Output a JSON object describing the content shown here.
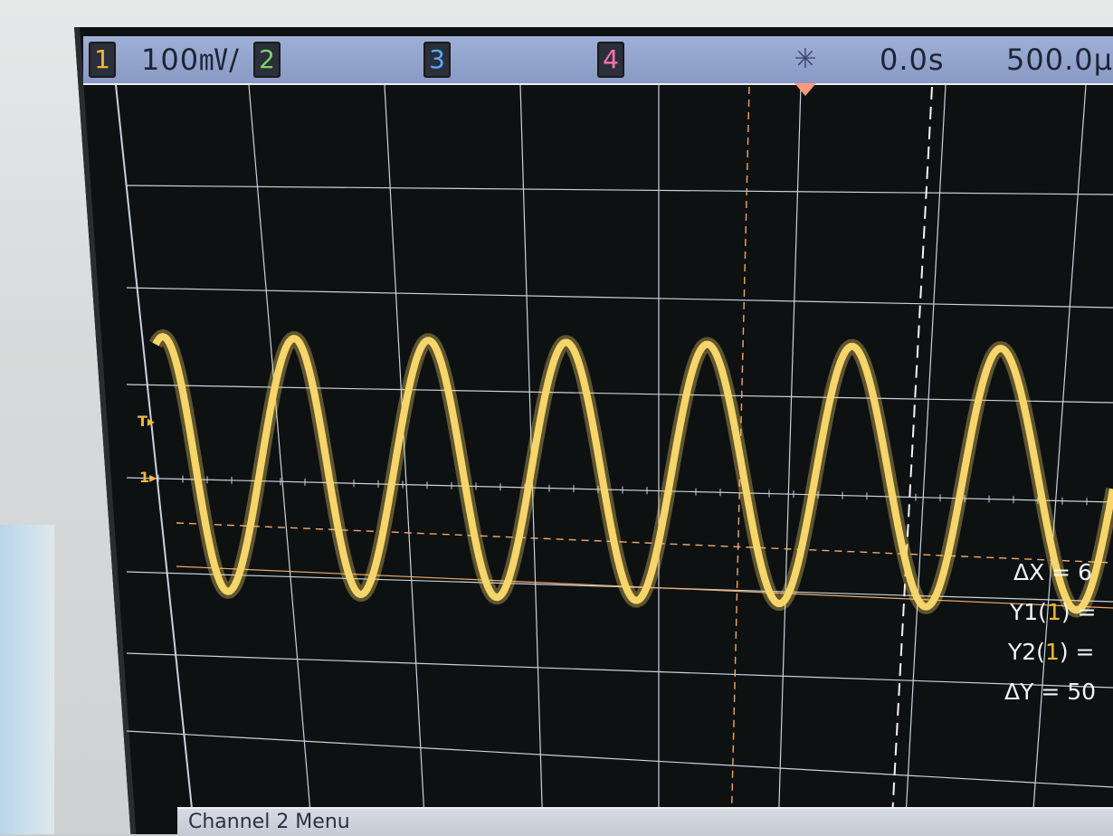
{
  "status_bar": {
    "channels": [
      {
        "label": "1",
        "color": "#f2b836"
      },
      {
        "label": "2",
        "color": "#7fd36a"
      },
      {
        "label": "3",
        "color": "#5ba8ff"
      },
      {
        "label": "4",
        "color": "#ff72b4"
      }
    ],
    "ch1_scale": "100㎷/",
    "acquire_icon": "starburst-icon",
    "trigger_delay": "0.0s",
    "timebase": "500.0µ/"
  },
  "markers": {
    "trigger_label": "T",
    "ground_label": "1"
  },
  "measurements": {
    "dx": {
      "prefix": "ΔX = 6"
    },
    "y1": {
      "prefix": "Y1(",
      "ch": "1",
      "suffix": ") ="
    },
    "y2": {
      "prefix": "Y2(",
      "ch": "1",
      "suffix": ") ="
    },
    "dy": {
      "prefix": "ΔY = 50"
    }
  },
  "softkey": {
    "label": "Channel 2  Menu"
  },
  "colors": {
    "trace": "#f6d56a",
    "cursor": "#f0a868",
    "grid": "#c9d2dc"
  }
}
